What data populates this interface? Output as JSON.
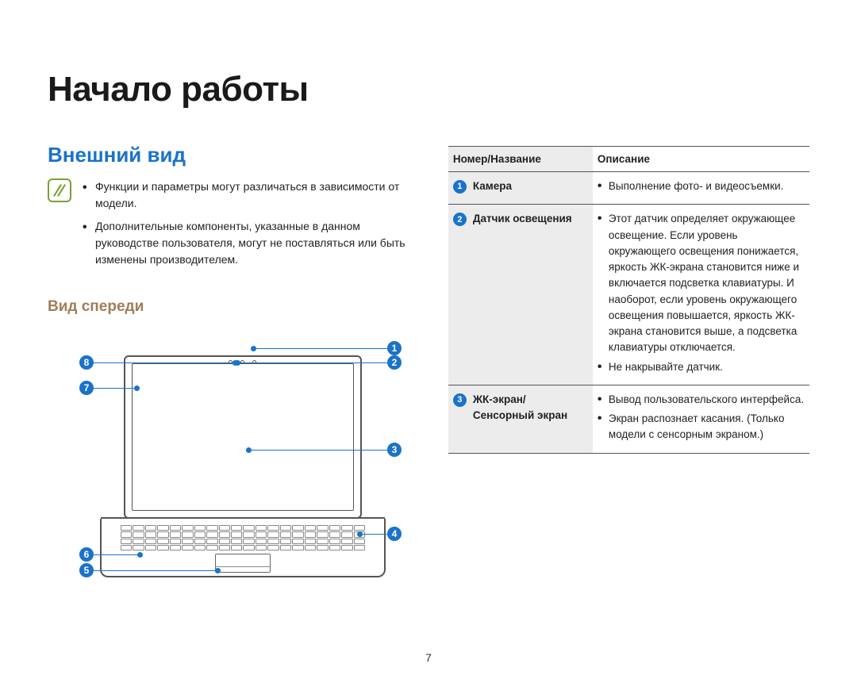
{
  "page": {
    "number": "7"
  },
  "title": "Начало работы",
  "section": "Внешний вид",
  "subsection": "Вид спереди",
  "notes": [
    "Функции и параметры могут различаться в зависимости от модели.",
    "Дополнительные компоненты, указанные в данном руководстве пользователя, могут не поставляться или быть изменены производителем."
  ],
  "diagram": {
    "callouts": {
      "c1": "1",
      "c2": "2",
      "c3": "3",
      "c4": "4",
      "c5": "5",
      "c6": "6",
      "c7": "7",
      "c8": "8"
    }
  },
  "table": {
    "headers": {
      "name": "Номер/Название",
      "desc": "Описание"
    },
    "rows": [
      {
        "num": "1",
        "name": "Камера",
        "desc": [
          "Выполнение фото- и видеосъемки."
        ]
      },
      {
        "num": "2",
        "name": "Датчик освещения",
        "desc": [
          "Этот датчик определяет окружающее освещение. Если уровень окружающего освещения понижается, яркость ЖК-экрана становится ниже и включается подсветка клавиатуры. И наоборот, если уровень окружающего освещения повышается, яркость ЖК-экрана становится выше, а подсветка клавиатуры отключается.",
          "Не накрывайте датчик."
        ]
      },
      {
        "num": "3",
        "name": "ЖК-экран/\nСенсорный экран",
        "desc": [
          "Вывод пользовательского интерфейса.",
          "Экран распознает касания. (Только модели с сенсорным экраном.)"
        ]
      }
    ]
  }
}
